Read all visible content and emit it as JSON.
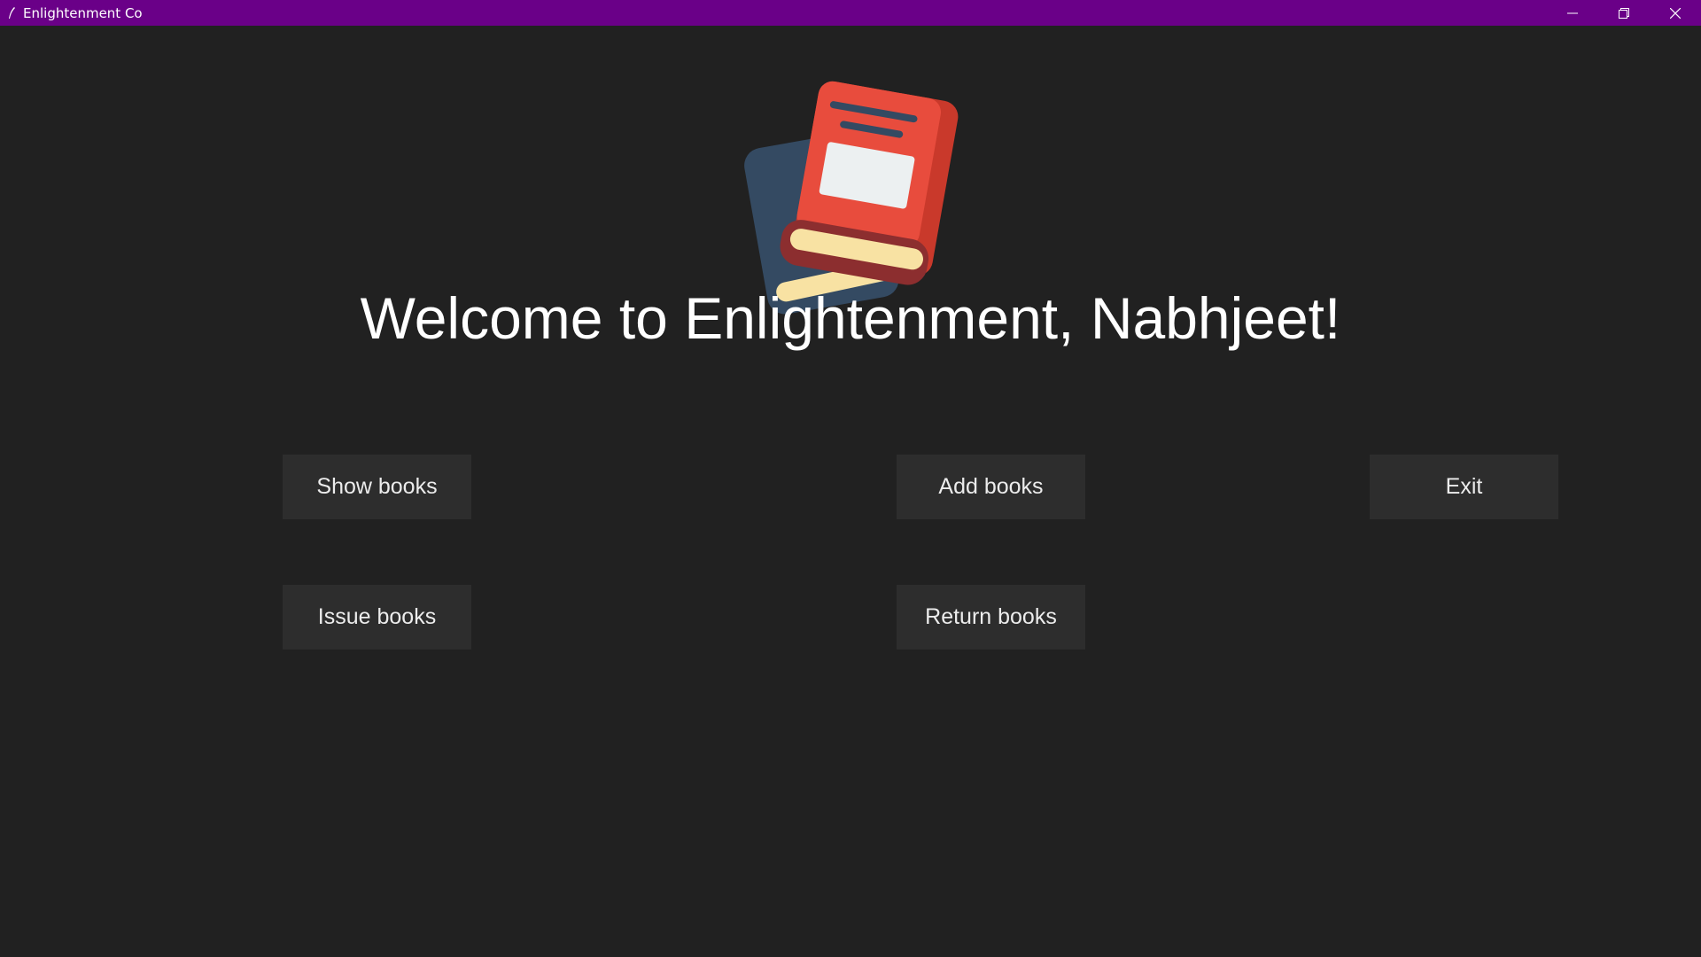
{
  "window": {
    "title": "Enlightenment Co",
    "app_icon": "feather-pen-icon",
    "controls": [
      "minimize-icon",
      "restore-icon",
      "close-icon"
    ],
    "titlebar_color": "#6a0088"
  },
  "main": {
    "background": "#212121",
    "logo_icon": "book-stack-icon",
    "welcome_text": "Welcome to Enlightenment, Nabhjeet!",
    "buttons": {
      "show_books": "Show books",
      "add_books": "Add books",
      "exit": "Exit",
      "issue_books": "Issue books",
      "return_books": "Return books"
    }
  }
}
